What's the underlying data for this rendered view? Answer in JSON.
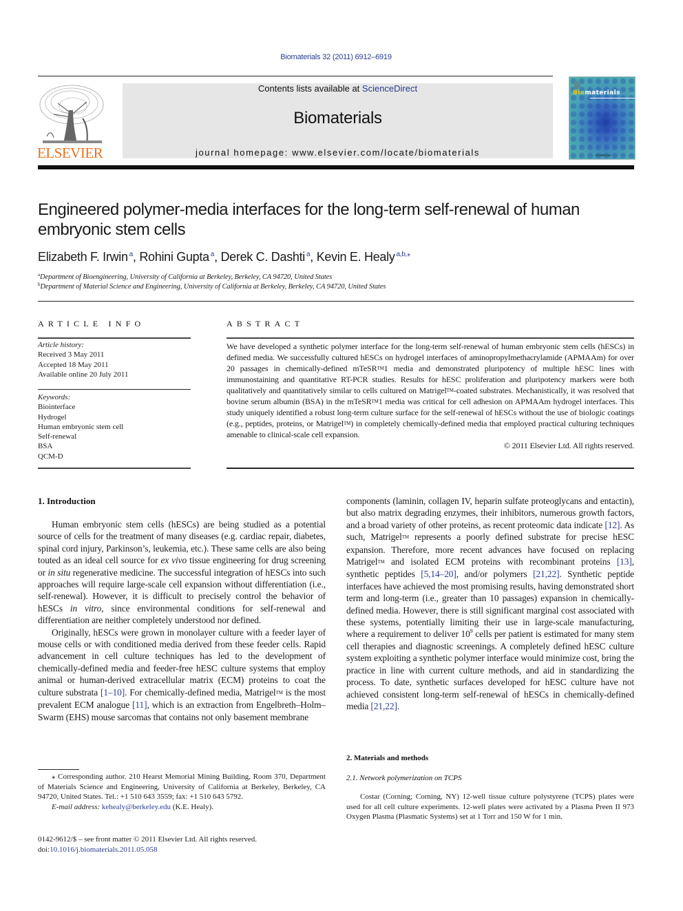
{
  "header": {
    "journal_reference": "Biomaterials 32 (2011) 6912–6919",
    "contents_prefix": "Contents lists available at ",
    "contents_link": "ScienceDirect",
    "journal_title": "Biomaterials",
    "homepage": "journal homepage: www.elsevier.com/locate/biomaterials",
    "publisher_logo_text": "ELSEVIER",
    "cover": {
      "title_highlight": "Bio",
      "title_rest": "materials"
    },
    "colors": {
      "link": "#2a3b8f",
      "publisher_orange": "#e9711c",
      "banner_bg": "#e6e6e6"
    }
  },
  "article": {
    "title": "Engineered polymer-media interfaces for the long-term self-renewal of human embryonic stem cells",
    "authors": [
      {
        "name": "Elizabeth F. Irwin",
        "sup": "a",
        "sep": ", "
      },
      {
        "name": "Rohini Gupta",
        "sup": "a",
        "sep": ", "
      },
      {
        "name": "Derek C. Dashti",
        "sup": "a",
        "sep": ", "
      },
      {
        "name": "Kevin E. Healy",
        "sup": "a,b,⁎",
        "sep": ""
      }
    ],
    "affiliations": [
      {
        "key": "a",
        "text": "Department of Bioengineering, University of California at Berkeley, Berkeley, CA 94720, United States"
      },
      {
        "key": "b",
        "text": "Department of Material Science and Engineering, University of California at Berkeley, Berkeley, CA 94720, United States"
      }
    ]
  },
  "article_info": {
    "heading": "ARTICLE INFO",
    "history_label": "Article history:",
    "history": [
      "Received 3 May 2011",
      "Accepted 18 May 2011",
      "Available online 20 July 2011"
    ],
    "keywords_label": "Keywords:",
    "keywords": [
      "Biointerface",
      "Hydrogel",
      "Human embryonic stem cell",
      "Self-renewal",
      "BSA",
      "QCM-D"
    ]
  },
  "abstract": {
    "heading": "ABSTRACT",
    "p1": "We have developed a synthetic polymer interface for the long-term self-renewal of human embryonic stem cells (hESCs) in defined media. We successfully cultured hESCs on hydrogel interfaces of aminopropylmethacrylamide (APMAAm) for over 20 passages in chemically-defined mTeSR",
    "tm": "TM",
    "p2": "1 media and demonstrated pluripotency of multiple hESC lines with immunostaining and quantitative RT-PCR studies. Results for hESC proliferation and pluripotency markers were both qualitatively and quantitatively similar to cells cultured on Matrigel",
    "p3": "-coated substrates. Mechanistically, it was resolved that bovine serum albumin (BSA) in the mTeSR",
    "p4": "1 media was critical for cell adhesion on APMAAm hydrogel interfaces. This study uniquely identified a robust long-term culture surface for the self-renewal of hESCs without the use of biologic coatings (e.g., peptides, proteins, or Matrigel",
    "p5": ") in completely chemically-defined media that employed practical culturing techniques amenable to clinical-scale cell expansion.",
    "copyright": "© 2011 Elsevier Ltd. All rights reserved."
  },
  "introduction": {
    "heading": "1.  Introduction",
    "para1_a": "Human embryonic stem cells (hESCs) are being studied as a potential source of cells for the treatment of many diseases (e.g. cardiac repair, diabetes, spinal cord injury, Parkinson’s, leukemia, etc.). These same cells are also being touted as an ideal cell source for ",
    "para1_em1": "ex vivo",
    "para1_b": " tissue engineering for drug screening or ",
    "para1_em2": "in situ",
    "para1_c": " regenerative medicine. The successful integration of hESCs into such approaches will require large-scale cell expansion without differentiation (i.e., self-renewal). However, it is difficult to precisely control the behavior of hESCs ",
    "para1_em3": "in vitro",
    "para1_d": ", since environmental conditions for self-renewal and differentiation are neither completely understood nor defined.",
    "para2_a": "Originally, hESCs were grown in monolayer culture with a feeder layer of mouse cells or with conditioned media derived from these feeder cells. Rapid advancement in cell culture techniques has led to the development of chemically-defined media and feeder-free hESC culture systems that employ animal or human-derived extracellular matrix (ECM) proteins to coat the culture substrata ",
    "ref_1_10": "[1–10]",
    "para2_b": ". For chemically-defined media, Matrigel",
    "para2_c": " is the most prevalent ECM analogue ",
    "ref_11": "[11]",
    "para2_d": ", which is an extraction from Engelbreth–Holm–Swarm (EHS) mouse sarcomas that contains not only basement membrane",
    "para3_a": "components (laminin, collagen IV, heparin sulfate proteoglycans and entactin), but also matrix degrading enzymes, their inhibitors, numerous growth factors, and a broad variety of other proteins, as recent proteomic data indicate ",
    "ref_12": "[12]",
    "para3_b": ". As such, Matrigel",
    "para3_c": " represents a poorly defined substrate for precise hESC expansion. Therefore, more recent advances have focused on replacing Matrigel",
    "para3_d": " and isolated ECM proteins with recombinant proteins ",
    "ref_13": "[13]",
    "para3_e": ", synthetic peptides ",
    "ref_5_14_20": "[5,14–20]",
    "para3_f": ", and/or polymers ",
    "ref_21_22": "[21,22]",
    "para3_g": ". Synthetic peptide interfaces have achieved the most promising results, having demonstrated short term and long-term (i.e., greater than 10 passages) expansion in chemically-defined media. However, there is still significant marginal cost associated with these systems, potentially limiting their use in large-scale manufacturing, where a requirement to deliver 10",
    "exp_9": "9",
    "para3_h": " cells per patient is estimated for many stem cell therapies and diagnostic screenings. A completely defined hESC culture system exploiting a synthetic polymer interface would minimize cost, bring the practice in line with current culture methods, and aid in standardizing the process. To date, synthetic surfaces developed for hESC culture have not achieved consistent long-term self-renewal of hESCs in chemically-defined media ",
    "ref_21_22_b": "[21,22]",
    "para3_i": "."
  },
  "methods": {
    "heading": "2.  Materials and methods",
    "subheading": "2.1.  Network polymerization on TCPS",
    "text": "Costar (Corning; Corning, NY) 12-well tissue culture polystyrene (TCPS) plates were used for all cell culture experiments. 12-well plates were activated by a Plasma Preen II 973 Oxygen Plasma (Plasmatic Systems) set at 1 Torr and 150 W for 1 min."
  },
  "footnotes": {
    "corresponding": "⁎ Corresponding author. 210 Hearst Memorial Mining Building, Room 370, Department of Materials Science and Engineering, University of California at Berkeley, Berkeley, CA 94720, United States. Tel.: +1 510 643 3559; fax: +1 510 643 5792.",
    "email_label": "E-mail address:",
    "email": "kehealy@berkeley.edu",
    "email_suffix": " (K.E. Healy).",
    "front_matter": "0142-9612/$ – see front matter © 2011 Elsevier Ltd. All rights reserved.",
    "doi_prefix": "doi:",
    "doi": "10.1016/j.biomaterials.2011.05.058"
  }
}
